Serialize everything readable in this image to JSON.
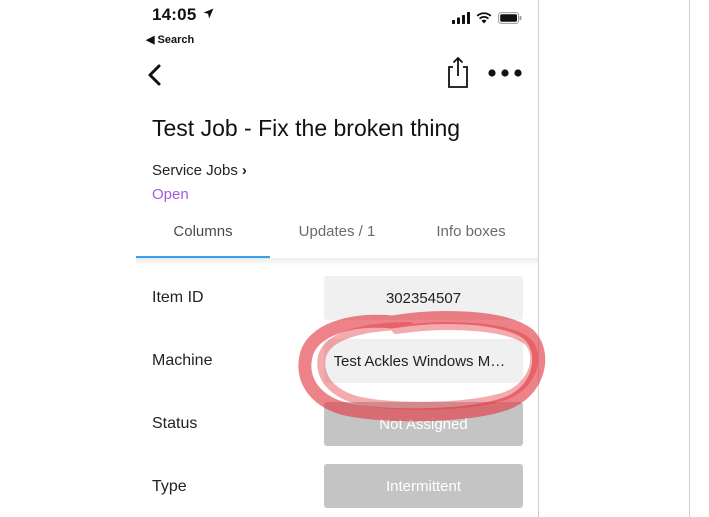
{
  "status_bar": {
    "time": "14:05",
    "back_app": "Search"
  },
  "item": {
    "title": "Test Job - Fix the broken thing",
    "board": "Service Jobs",
    "group": "Open"
  },
  "tabs": [
    {
      "label": "Columns",
      "active": true
    },
    {
      "label": "Updates / 1",
      "active": false
    },
    {
      "label": "Info boxes",
      "active": false
    }
  ],
  "fields": [
    {
      "label": "Item ID",
      "value": "302354507"
    },
    {
      "label": "Machine",
      "value": "Test Ackles Windows Machine"
    },
    {
      "label": "Status",
      "value": "Not Assigned"
    },
    {
      "label": "Type",
      "value": "Intermittent"
    }
  ],
  "colors": {
    "tab_accent": "#3ea0e8",
    "group_color": "#a25ddc",
    "status_grey": "#c4c4c4",
    "annotation_red": "#e2373f"
  },
  "icons": [
    "location-arrow-icon",
    "signal-icon",
    "wifi-icon",
    "battery-icon",
    "chevron-left-icon",
    "share-icon",
    "more-icon",
    "chevron-right-icon"
  ]
}
